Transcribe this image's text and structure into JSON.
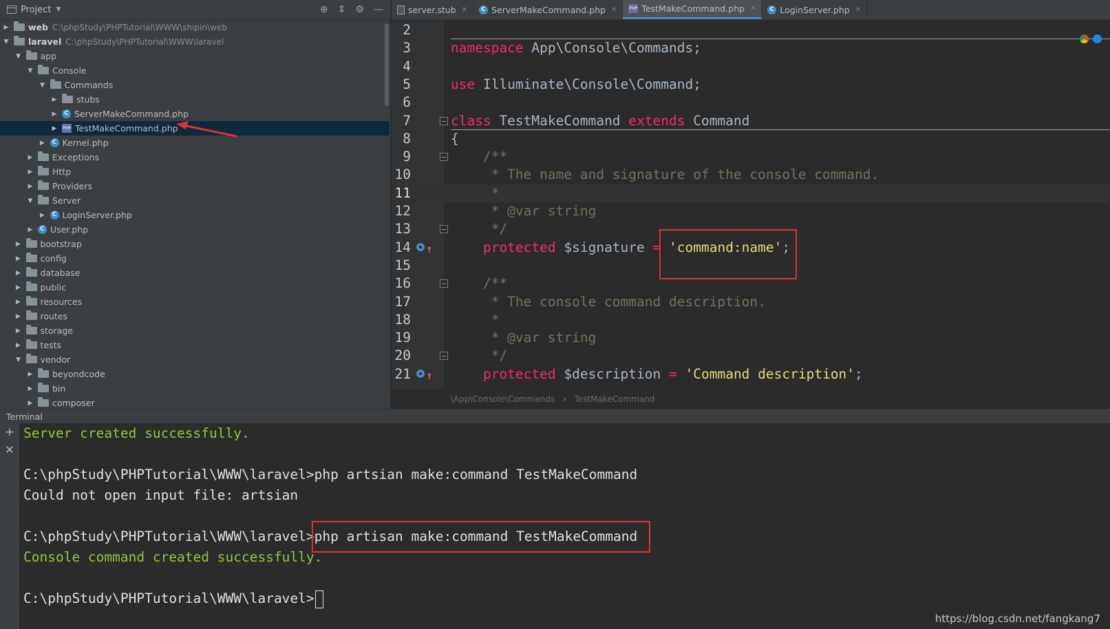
{
  "project_panel": {
    "title": "Project",
    "icons": [
      "globe-icon",
      "collapse-icon",
      "gear-icon",
      "minimize-icon"
    ],
    "tree": [
      {
        "label": "web",
        "path": "C:\\phpStudy\\PHPTutorial\\WWW\\shipin\\web",
        "type": "root",
        "expanded": false,
        "depth": 0
      },
      {
        "label": "laravel",
        "path": "C:\\phpStudy\\PHPTutorial\\WWW\\laravel",
        "type": "root",
        "expanded": true,
        "depth": 0
      },
      {
        "label": "app",
        "type": "folder",
        "expanded": true,
        "depth": 1
      },
      {
        "label": "Console",
        "type": "folder",
        "expanded": true,
        "depth": 2
      },
      {
        "label": "Commands",
        "type": "folder",
        "expanded": true,
        "depth": 3
      },
      {
        "label": "stubs",
        "type": "folder",
        "expanded": false,
        "depth": 4
      },
      {
        "label": "ServerMakeCommand.php",
        "type": "class",
        "expanded": false,
        "depth": 4
      },
      {
        "label": "TestMakeCommand.php",
        "type": "php",
        "expanded": false,
        "depth": 4,
        "selected": true
      },
      {
        "label": "Kernel.php",
        "type": "class",
        "expanded": false,
        "depth": 3
      },
      {
        "label": "Exceptions",
        "type": "folder",
        "expanded": false,
        "depth": 2
      },
      {
        "label": "Http",
        "type": "folder",
        "expanded": false,
        "depth": 2
      },
      {
        "label": "Providers",
        "type": "folder",
        "expanded": false,
        "depth": 2
      },
      {
        "label": "Server",
        "type": "folder",
        "expanded": true,
        "depth": 2
      },
      {
        "label": "LoginServer.php",
        "type": "class",
        "expanded": false,
        "depth": 3
      },
      {
        "label": "User.php",
        "type": "class",
        "expanded": false,
        "depth": 2
      },
      {
        "label": "bootstrap",
        "type": "folder",
        "expanded": false,
        "depth": 1
      },
      {
        "label": "config",
        "type": "folder",
        "expanded": false,
        "depth": 1
      },
      {
        "label": "database",
        "type": "folder",
        "expanded": false,
        "depth": 1
      },
      {
        "label": "public",
        "type": "folder",
        "expanded": false,
        "depth": 1
      },
      {
        "label": "resources",
        "type": "folder",
        "expanded": false,
        "depth": 1
      },
      {
        "label": "routes",
        "type": "folder",
        "expanded": false,
        "depth": 1
      },
      {
        "label": "storage",
        "type": "folder",
        "expanded": false,
        "depth": 1
      },
      {
        "label": "tests",
        "type": "folder",
        "expanded": false,
        "depth": 1
      },
      {
        "label": "vendor",
        "type": "folder",
        "expanded": true,
        "depth": 1
      },
      {
        "label": "beyondcode",
        "type": "folder",
        "expanded": false,
        "depth": 2
      },
      {
        "label": "bin",
        "type": "folder",
        "expanded": false,
        "depth": 2
      },
      {
        "label": "composer",
        "type": "folder",
        "expanded": false,
        "depth": 2
      }
    ]
  },
  "tabs": [
    {
      "label": "server.stub",
      "icon": "stub-file-icon",
      "active": false
    },
    {
      "label": "ServerMakeCommand.php",
      "icon": "class-icon",
      "active": false
    },
    {
      "label": "TestMakeCommand.php",
      "icon": "php-file-icon",
      "active": true
    },
    {
      "label": "LoginServer.php",
      "icon": "class-icon",
      "active": false
    }
  ],
  "code_lines": [
    {
      "n": "2",
      "parts": []
    },
    {
      "n": "3",
      "parts": [
        [
          "kw",
          "namespace"
        ],
        [
          "",
          " App\\Console\\Commands;"
        ]
      ]
    },
    {
      "n": "4",
      "parts": []
    },
    {
      "n": "5",
      "parts": [
        [
          "kw",
          "use"
        ],
        [
          "",
          " Illuminate\\Console\\Command;"
        ]
      ]
    },
    {
      "n": "6",
      "parts": []
    },
    {
      "n": "7",
      "parts": [
        [
          "kw",
          "class"
        ],
        [
          "",
          " TestMakeCommand "
        ],
        [
          "kw",
          "extends"
        ],
        [
          "",
          " Command"
        ]
      ]
    },
    {
      "n": "8",
      "parts": [
        [
          "",
          "{"
        ]
      ]
    },
    {
      "n": "9",
      "parts": [
        [
          "cm",
          "    /**"
        ]
      ]
    },
    {
      "n": "10",
      "parts": [
        [
          "cm",
          "     * The name and signature of the console command."
        ]
      ]
    },
    {
      "n": "11",
      "parts": [
        [
          "cm",
          "     *"
        ]
      ],
      "current": true
    },
    {
      "n": "12",
      "parts": [
        [
          "cm",
          "     * @var string"
        ]
      ]
    },
    {
      "n": "13",
      "parts": [
        [
          "cm",
          "     */"
        ]
      ]
    },
    {
      "n": "14",
      "parts": [
        [
          "kw",
          "    protected"
        ],
        [
          "",
          " $signature "
        ],
        [
          "op",
          "="
        ],
        [
          "",
          " "
        ],
        [
          "st",
          "'command:name'"
        ],
        [
          "",
          ";"
        ]
      ],
      "override": true
    },
    {
      "n": "15",
      "parts": []
    },
    {
      "n": "16",
      "parts": [
        [
          "cm",
          "    /**"
        ]
      ]
    },
    {
      "n": "17",
      "parts": [
        [
          "cm",
          "     * The console command description."
        ]
      ]
    },
    {
      "n": "18",
      "parts": [
        [
          "cm",
          "     *"
        ]
      ]
    },
    {
      "n": "19",
      "parts": [
        [
          "cm",
          "     * @var string"
        ]
      ]
    },
    {
      "n": "20",
      "parts": [
        [
          "cm",
          "     */"
        ]
      ]
    },
    {
      "n": "21",
      "parts": [
        [
          "kw",
          "    protected"
        ],
        [
          "",
          " $description "
        ],
        [
          "op",
          "="
        ],
        [
          "",
          " "
        ],
        [
          "st",
          "'Command description'"
        ],
        [
          "",
          ";"
        ]
      ],
      "override": true
    }
  ],
  "breadcrumb": [
    "\\App\\Console\\Commands",
    "TestMakeCommand"
  ],
  "terminal": {
    "title": "Terminal",
    "lines": [
      {
        "text": "Server created successfully.",
        "ok": true
      },
      {
        "text": "",
        "ok": false
      },
      {
        "text": "C:\\phpStudy\\PHPTutorial\\WWW\\laravel>php artsian make:command TestMakeCommand",
        "ok": false
      },
      {
        "text": "Could not open input file: artsian",
        "ok": false
      },
      {
        "text": "",
        "ok": false
      },
      {
        "text": "C:\\phpStudy\\PHPTutorial\\WWW\\laravel>php artisan make:command TestMakeCommand",
        "ok": false
      },
      {
        "text": "Console command created successfully.",
        "ok": true
      },
      {
        "text": "",
        "ok": false
      },
      {
        "text": "C:\\phpStudy\\PHPTutorial\\WWW\\laravel>",
        "ok": false,
        "cursor": true
      }
    ]
  },
  "watermark": "https://blog.csdn.net/fangkang7",
  "colors": {
    "keyword": "#f92672",
    "string": "#e6db74",
    "comment": "#75715e",
    "success": "#8fc83a",
    "annotation": "#e0312f",
    "selection": "#0d293e"
  }
}
